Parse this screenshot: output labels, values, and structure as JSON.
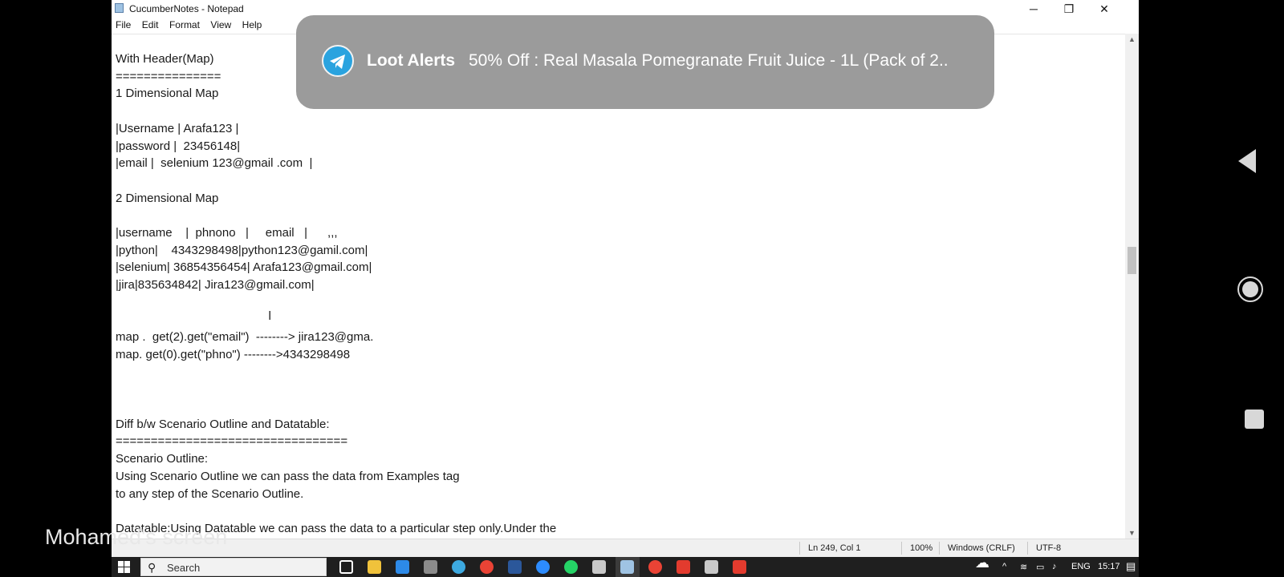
{
  "window": {
    "title": "CucumberNotes - Notepad",
    "minimize_glyph": "─",
    "restore_glyph": "❐",
    "close_glyph": "✕"
  },
  "menu": [
    "File",
    "Edit",
    "Format",
    "View",
    "Help"
  ],
  "editor": {
    "lines": [
      "With Header(Map)",
      "===============",
      "1 Dimensional Map",
      "",
      "|Username | Arafa123 |",
      "|password |  23456148|",
      "|email |  selenium 123@gmail .com  |",
      "",
      "2 Dimensional Map",
      "",
      "|username    |  phnono   |     email   |      ,,,",
      "|python|    4343298498|python123@gamil.com|",
      "|selenium| 36854356454| Arafa123@gmail.com|",
      "|jira|835634842| Jira123@gmail.com|",
      "",
      "",
      "map .  get(2).get(\"email\")  --------> jira123@gma.",
      "map. get(0).get(\"phno\") -------->4343298498",
      "",
      "",
      "",
      "Diff b/w Scenario Outline and Datatable:",
      "=================================",
      "Scenario Outline:",
      "Using Scenario Outline we can pass the data from Examples tag",
      "to any step of the Scenario Outline.",
      "",
      "Datatable:Using Datatable we can pass the data to a particular step only.Under the"
    ],
    "cursor_glyph": "I"
  },
  "status": {
    "position": "Ln 249, Col 1",
    "zoom": "100%",
    "line_ending": "Windows (CRLF)",
    "encoding": "UTF-8"
  },
  "taskbar": {
    "search_placeholder": "Search",
    "language": "ENG",
    "time": "15:17",
    "apps": [
      "task-view",
      "file-explorer",
      "mail",
      "settings",
      "edge",
      "chrome",
      "word",
      "zoom",
      "whatsapp",
      "sticky",
      "notepad",
      "chrome-2",
      "wps",
      "app-2",
      "snipping"
    ],
    "app_colors": [
      "#ffffff",
      "#f0c23b",
      "#2d8ae8",
      "#8b8b8b",
      "#3da9e0",
      "#ea4335",
      "#2b579a",
      "#2d8cff",
      "#25d366",
      "#c9c9c9",
      "#9fc3e3",
      "#ea4335",
      "#e33b2e",
      "#c9c9c9",
      "#e33b2e"
    ]
  },
  "notification": {
    "app": "Loot Alerts",
    "message": "50% Off : Real Masala Pomegranate Fruit Juice - 1L (Pack of 2..",
    "icon": "telegram-icon",
    "accent": "#2aa3df"
  },
  "overlay_text": "Mohamed's screen",
  "android_nav": [
    "back",
    "home",
    "recents"
  ]
}
